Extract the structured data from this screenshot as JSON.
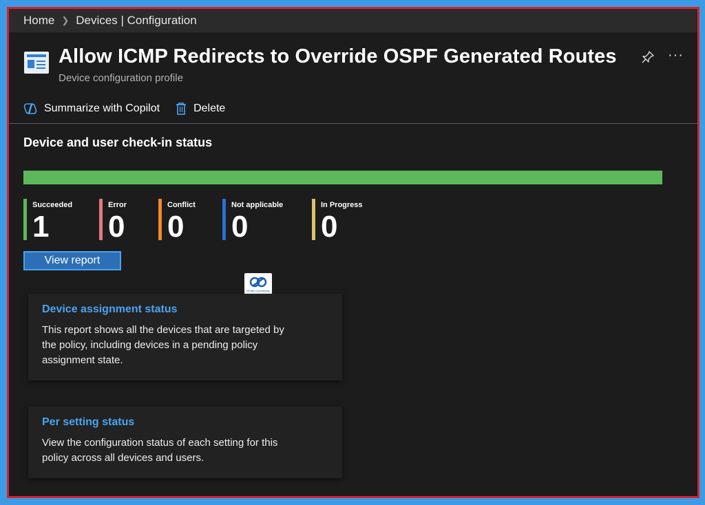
{
  "breadcrumb": {
    "home": "Home",
    "current": "Devices | Configuration"
  },
  "header": {
    "title": "Allow ICMP Redirects to Override OSPF Generated Routes",
    "subtitle": "Device configuration profile",
    "more_label": "···"
  },
  "toolbar": {
    "copilot_label": "Summarize with Copilot",
    "delete_label": "Delete"
  },
  "checkin": {
    "title": "Device and user check-in status",
    "progress_succeeded_fraction": 1.0,
    "stats": [
      {
        "label": "Succeeded",
        "value": "1",
        "color": "#5db85c"
      },
      {
        "label": "Error",
        "value": "0",
        "color": "#e07a7e"
      },
      {
        "label": "Conflict",
        "value": "0",
        "color": "#f08a2c"
      },
      {
        "label": "Not applicable",
        "value": "0",
        "color": "#2b6fd6"
      },
      {
        "label": "In Progress",
        "value": "0",
        "color": "#d9c070"
      }
    ],
    "view_report_label": "View report"
  },
  "watermark": {
    "text": "HTMD Community"
  },
  "cards": [
    {
      "title": "Device assignment status",
      "description": "This report shows all the devices that are targeted by the policy, including devices in a pending policy assignment state."
    },
    {
      "title": "Per setting status",
      "description": "View the configuration status of each setting for this policy across all devices and users."
    }
  ],
  "colors": {
    "accent": "#4aa3f0",
    "frame_border": "#d6232b",
    "outer_background": "#3d9be6",
    "panel_background": "#1c1c1c"
  }
}
